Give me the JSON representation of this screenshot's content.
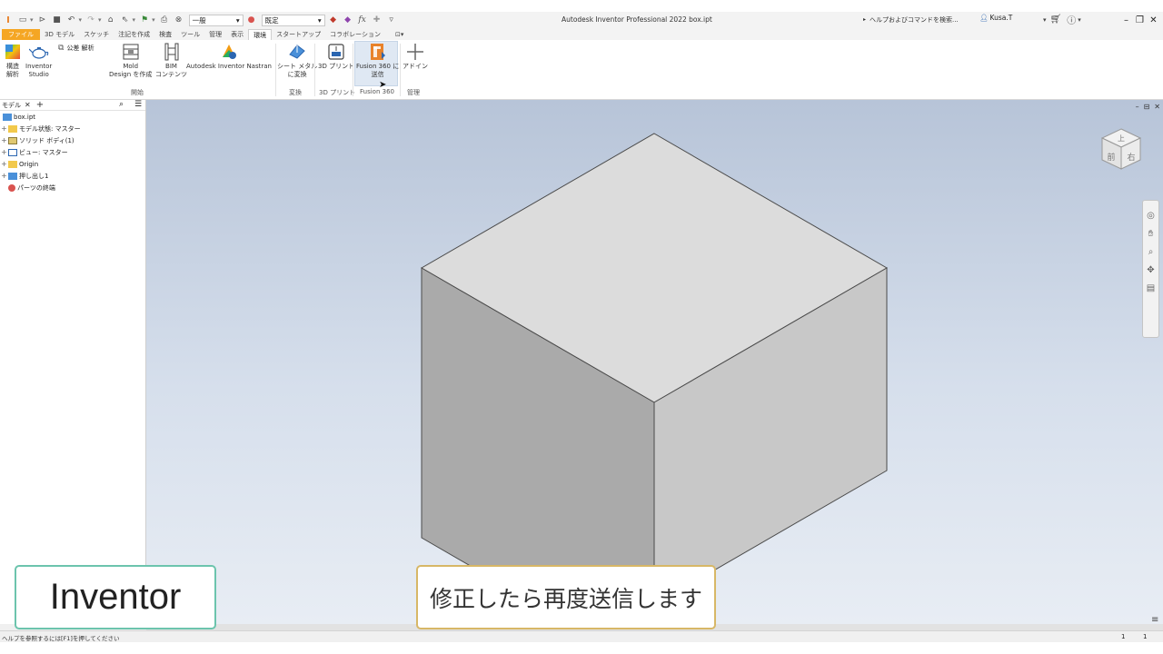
{
  "qat": {
    "style_value": "一般",
    "material_value": "既定",
    "fx": "fx"
  },
  "title": "Autodesk Inventor Professional 2022   box.ipt",
  "search": {
    "placeholder": "ヘルプおよびコマンドを検索..."
  },
  "user": {
    "name": "Kusa.T"
  },
  "tabs": [
    {
      "label": "ファイル"
    },
    {
      "label": "3D モデル"
    },
    {
      "label": "スケッチ"
    },
    {
      "label": "注記を作成"
    },
    {
      "label": "検査"
    },
    {
      "label": "ツール"
    },
    {
      "label": "管理"
    },
    {
      "label": "表示"
    },
    {
      "label": "環境"
    },
    {
      "label": "スタートアップ"
    },
    {
      "label": "コラボレーション"
    }
  ],
  "ribbon": {
    "stress_label": "構造\n解析",
    "studio_label": "Inventor\nStudio",
    "tolerance_label": "公差 解析",
    "mold_label": "Mold\nDesign を作成",
    "bim_label": "BIM\nコンテンツ",
    "nastran_label": "Autodesk Inventor Nastran",
    "sheetmetal_label": "シート メタル\nに変換",
    "print3d_label": "3D プリント",
    "fusion_label": "Fusion 360 に\n送信",
    "addin_label": "アドイン",
    "panels": {
      "start": "開始",
      "convert": "変換",
      "print3d": "3D プリント",
      "fusion": "Fusion 360",
      "manage": "管理"
    }
  },
  "browser": {
    "tab_label": "モデル",
    "items": [
      {
        "label": "box.ipt"
      },
      {
        "label": "モデル状態: マスター"
      },
      {
        "label": "ソリッド ボディ(1)"
      },
      {
        "label": "ビュー: マスター"
      },
      {
        "label": "Origin"
      },
      {
        "label": "押し出し1"
      },
      {
        "label": "パーツの終端"
      }
    ]
  },
  "viewcube": {
    "top": "上",
    "front": "前",
    "right": "右"
  },
  "status": {
    "help_text": "ヘルプを参照するには[F1]を押してください",
    "n1": "1",
    "n2": "1"
  },
  "captions": {
    "left": "Inventor",
    "right": "修正したら再度送信します"
  },
  "colors": {
    "file_tab": "#f5a623",
    "fusion_icon": "#e8822a",
    "caption_left_border": "#6cc4ad",
    "caption_right_border": "#d7b766"
  }
}
